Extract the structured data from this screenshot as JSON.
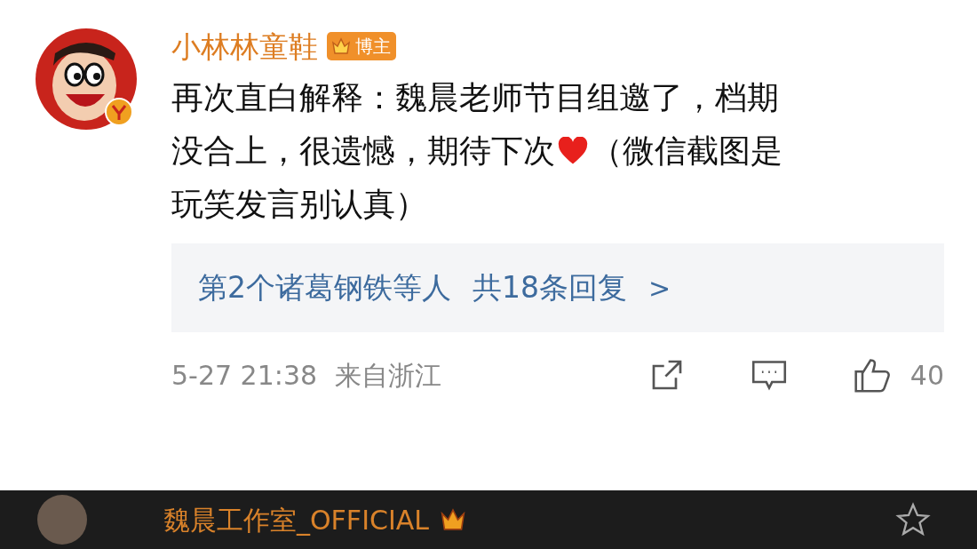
{
  "comment": {
    "author": "小林林童鞋",
    "badge": "博主",
    "text_lines": [
      {
        "segments": [
          {
            "kind": "text",
            "text": "再次直白解释：魏晨老师节目组邀了，档期"
          }
        ]
      },
      {
        "segments": [
          {
            "kind": "text",
            "text": "没合上，很遗憾，期待下次"
          },
          {
            "kind": "heart"
          },
          {
            "kind": "text",
            "text": "（微信截图是"
          }
        ]
      },
      {
        "segments": [
          {
            "kind": "text",
            "text": "玩笑发言别认真）"
          }
        ]
      }
    ],
    "replies": {
      "participants": "第2个诸葛钢铁等人",
      "count": "共18条回复",
      "arrow": ">"
    },
    "time": "5-27 21:38",
    "location": "来自浙江",
    "likes": "40"
  },
  "next_comment": {
    "author": "魏晨工作室_OFFICIAL"
  }
}
